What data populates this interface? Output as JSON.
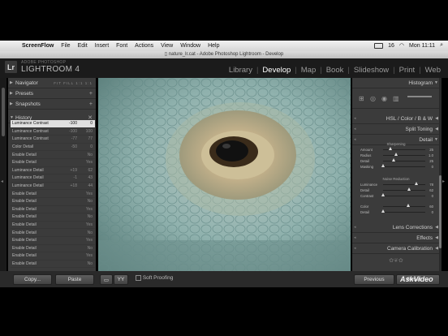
{
  "menubar": {
    "app": "ScreenFlow",
    "items": [
      "File",
      "Edit",
      "Insert",
      "Font",
      "Actions",
      "View",
      "Window",
      "Help"
    ],
    "right_status": "16",
    "clock": "Mon 11:11"
  },
  "window_title": "nature_lr.cat - Adobe Photoshop Lightroom - Develop",
  "brand": {
    "logo": "Lr",
    "small": "ADOBE PHOTOSHOP",
    "name": "LIGHTROOM 4"
  },
  "modules": [
    {
      "label": "Library",
      "active": false
    },
    {
      "label": "Develop",
      "active": true
    },
    {
      "label": "Map",
      "active": false
    },
    {
      "label": "Book",
      "active": false
    },
    {
      "label": "Slideshow",
      "active": false
    },
    {
      "label": "Print",
      "active": false
    },
    {
      "label": "Web",
      "active": false
    }
  ],
  "left_panels": {
    "navigator": "Navigator",
    "navigator_opts": "FIT FILL 1:1 1:1",
    "presets": "Presets",
    "snapshots": "Snapshots",
    "history": "History"
  },
  "history": [
    {
      "label": "Luminance Contrast",
      "v1": "-100",
      "v2": "0",
      "selected": true
    },
    {
      "label": "Luminance Contrast",
      "v1": "-100",
      "v2": "100",
      "selected": false
    },
    {
      "label": "Luminance Contrast",
      "v1": "-77",
      "v2": "77",
      "selected": false
    },
    {
      "label": "Color Detail",
      "v1": "-50",
      "v2": "0",
      "selected": false
    },
    {
      "label": "Enable Detail",
      "v1": "",
      "v2": "No",
      "selected": false
    },
    {
      "label": "Enable Detail",
      "v1": "",
      "v2": "Yes",
      "selected": false
    },
    {
      "label": "Luminance Detail",
      "v1": "+19",
      "v2": "62",
      "selected": false
    },
    {
      "label": "Luminance Detail",
      "v1": "-1",
      "v2": "43",
      "selected": false
    },
    {
      "label": "Luminance Detail",
      "v1": "+18",
      "v2": "44",
      "selected": false
    },
    {
      "label": "Enable Detail",
      "v1": "",
      "v2": "Yes",
      "selected": false
    },
    {
      "label": "Enable Detail",
      "v1": "",
      "v2": "No",
      "selected": false
    },
    {
      "label": "Enable Detail",
      "v1": "",
      "v2": "Yes",
      "selected": false
    },
    {
      "label": "Enable Detail",
      "v1": "",
      "v2": "No",
      "selected": false
    },
    {
      "label": "Enable Detail",
      "v1": "",
      "v2": "Yes",
      "selected": false
    },
    {
      "label": "Enable Detail",
      "v1": "",
      "v2": "No",
      "selected": false
    },
    {
      "label": "Enable Detail",
      "v1": "",
      "v2": "Yes",
      "selected": false
    },
    {
      "label": "Enable Detail",
      "v1": "",
      "v2": "No",
      "selected": false
    },
    {
      "label": "Enable Detail",
      "v1": "",
      "v2": "Yes",
      "selected": false
    },
    {
      "label": "Enable Detail",
      "v1": "",
      "v2": "No",
      "selected": false
    },
    {
      "label": "Enable Detail",
      "v1": "",
      "v2": "Yes",
      "selected": false
    },
    {
      "label": "Enable Detail",
      "v1": "",
      "v2": "No",
      "selected": false
    }
  ],
  "right_panels": {
    "histogram": "Histogram",
    "hsl": "HSL / Color / B & W",
    "split_toning": "Split Toning",
    "detail": "Detail",
    "lens": "Lens Corrections",
    "effects": "Effects",
    "camera": "Camera Calibration"
  },
  "detail": {
    "sharpening_title": "Sharpening",
    "sharpening": [
      {
        "label": "Amount",
        "value": "25",
        "level": 0.17
      },
      {
        "label": "Radius",
        "value": "1.0",
        "level": 0.3
      },
      {
        "label": "Detail",
        "value": "25",
        "level": 0.25
      },
      {
        "label": "Masking",
        "value": "0",
        "level": 0.0
      }
    ],
    "noise_title": "Noise Reduction",
    "luminance": [
      {
        "label": "Luminance",
        "value": "78",
        "level": 0.78
      },
      {
        "label": "Detail",
        "value": "62",
        "level": 0.62
      },
      {
        "label": "Contrast",
        "value": "0",
        "level": 0.0
      }
    ],
    "color": [
      {
        "label": "Color",
        "value": "60",
        "level": 0.6
      },
      {
        "label": "Detail",
        "value": "0",
        "level": 0.0
      }
    ]
  },
  "bottom": {
    "copy": "Copy...",
    "paste": "Paste",
    "soft_proofing": "Soft Proofing",
    "previous": "Previous",
    "reset": "Reset",
    "watermark": "AskVideo"
  },
  "colors": {
    "panel": "#3b3b3b",
    "selected_row": "#e0e0e0",
    "active_module": "#ffffff"
  }
}
